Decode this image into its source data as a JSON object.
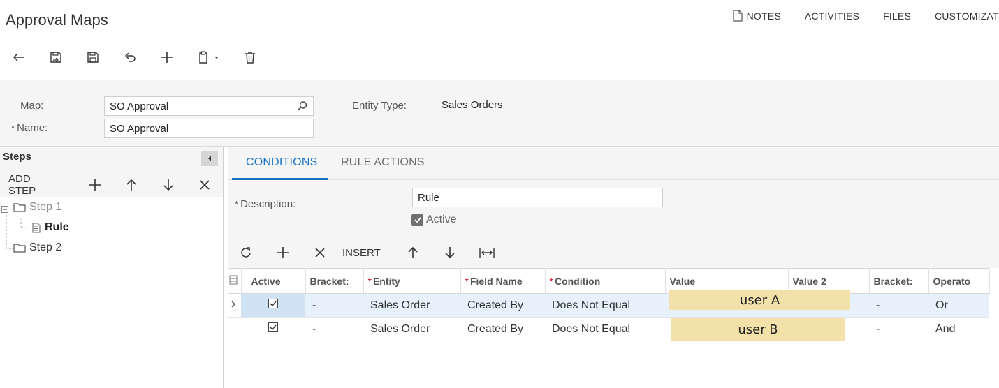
{
  "header": {
    "title": "Approval Maps",
    "links": [
      {
        "label": "NOTES",
        "icon": "document-icon"
      },
      {
        "label": "ACTIVITIES"
      },
      {
        "label": "FILES"
      },
      {
        "label": "CUSTOMIZAT"
      }
    ]
  },
  "toolbar": {
    "buttons": [
      "back-icon",
      "save-and-close-icon",
      "save-icon",
      "undo-icon",
      "add-icon",
      "copy-paste-icon",
      "delete-icon"
    ]
  },
  "form": {
    "map_label": "Map:",
    "map_value": "SO Approval",
    "name_label": "Name:",
    "name_value": "SO Approval",
    "entity_type_label": "Entity Type:",
    "entity_type_value": "Sales Orders"
  },
  "steps": {
    "title": "Steps",
    "add_step_label": "ADD STEP",
    "tree": [
      {
        "label": "Step 1",
        "children": [
          {
            "label": "Rule"
          }
        ]
      },
      {
        "label": "Step 2"
      }
    ]
  },
  "tabs": [
    {
      "label": "CONDITIONS",
      "active": true
    },
    {
      "label": "RULE ACTIONS",
      "active": false
    }
  ],
  "conditions": {
    "description_label": "Description:",
    "description_value": "Rule",
    "active_label": "Active",
    "active_checked": true,
    "insert_label": "INSERT"
  },
  "grid": {
    "columns": [
      "Active",
      "Bracket:",
      "Entity",
      "Field Name",
      "Condition",
      "Value",
      "Value 2",
      "Bracket:",
      "Operato"
    ],
    "rows": [
      {
        "active": true,
        "bracket_open": "-",
        "entity": "Sales Order",
        "field": "Created By",
        "condition": "Does Not Equal",
        "value": "user A",
        "value2": "",
        "bracket_close": "-",
        "operator": "Or"
      },
      {
        "active": true,
        "bracket_open": "-",
        "entity": "Sales Order",
        "field": "Created By",
        "condition": "Does Not Equal",
        "value": "user B",
        "value2": "",
        "bracket_close": "-",
        "operator": "And"
      }
    ]
  },
  "colors": {
    "accent": "#1a73c7",
    "panel_bg": "#f5f5f5",
    "selected_row": "#e6f1fb",
    "highlight": "#f2e1a8",
    "required": "#d9001b"
  }
}
